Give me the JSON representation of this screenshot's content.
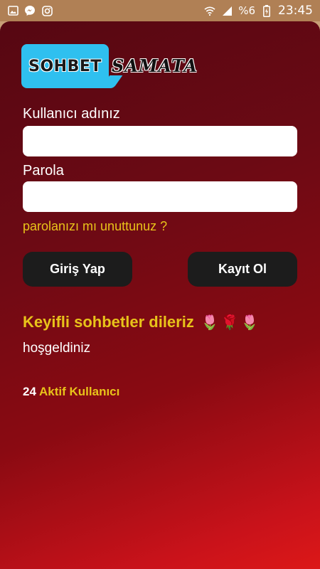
{
  "status_bar": {
    "icons_left": [
      "image-icon",
      "messenger-icon",
      "instagram-icon"
    ],
    "battery_percent": "%6",
    "time": "23:45"
  },
  "logo": {
    "word1": "SOHBET",
    "word2": "SAMATA",
    "box_color": "#2fc0ef"
  },
  "form": {
    "username_label": "Kullanıcı adınız",
    "username_value": "",
    "password_label": "Parola",
    "password_value": "",
    "forgot_link": "parolanızı mı unuttunuz ?",
    "login_button": "Giriş Yap",
    "register_button": "Kayıt Ol"
  },
  "welcome": {
    "headline": "Keyifli sohbetler dileriz",
    "flowers": [
      "🌷",
      "🌹",
      "🌷"
    ],
    "greeting": "hoşgeldiniz"
  },
  "active_users": {
    "count": "24",
    "label": "Aktif Kullanıcı"
  },
  "colors": {
    "accent": "#e8c31a",
    "background_dark": "#560712",
    "background_light": "#dc1818",
    "button": "#1c1c1c"
  }
}
